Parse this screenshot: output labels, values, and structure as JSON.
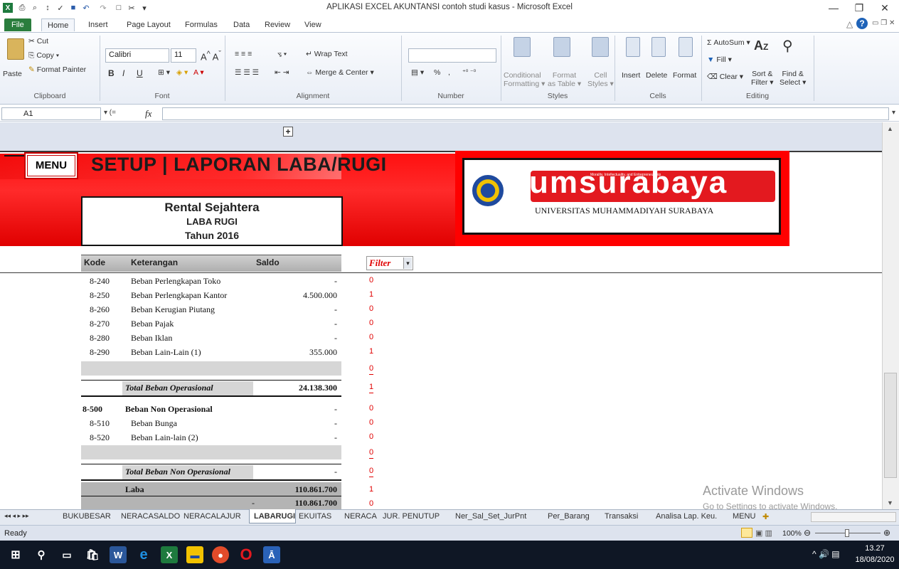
{
  "window": {
    "title": "APLIKASI EXCEL AKUNTANSI contoh studi kasus  -  Microsoft Excel",
    "min": "—",
    "restore": "❐",
    "close": "✕"
  },
  "ribbon_tabs": [
    "File",
    "Home",
    "Insert",
    "Page Layout",
    "Formulas",
    "Data",
    "Review",
    "View"
  ],
  "clipboard": {
    "paste": "Paste",
    "cut": "Cut",
    "copy": "Copy ▾",
    "format_painter": "Format Painter",
    "label": "Clipboard"
  },
  "font": {
    "name": "Calibri",
    "size": "11",
    "bold": "B",
    "italic": "I",
    "underline": "U",
    "label": "Font"
  },
  "alignment": {
    "wrap": "Wrap Text",
    "merge": "Merge & Center",
    "label": "Alignment"
  },
  "number": {
    "percent": "%",
    "comma": ",",
    "label": "Number"
  },
  "styles": {
    "conditional_1": "Conditional",
    "conditional_2": "Formatting ▾",
    "format_1": "Format",
    "format_2": "as Table ▾",
    "cell_1": "Cell",
    "cell_2": "Styles ▾",
    "label": "Styles"
  },
  "cells": {
    "insert": "Insert",
    "delete": "Delete",
    "format": "Format",
    "label": "Cells"
  },
  "editing": {
    "autosum": "Σ AutoSum ▾",
    "fill": "Fill ▾",
    "clear": "Clear ▾",
    "sort_1": "Sort &",
    "sort_2": "Filter ▾",
    "find_1": "Find &",
    "find_2": "Select ▾",
    "label": "Editing"
  },
  "formula_bar": {
    "cell_ref": "A1",
    "fx": "fx",
    "value": ""
  },
  "sheet": {
    "menu_button": "MENU",
    "heading": "SETUP | LAPORAN LABA/RUGI",
    "company": "Rental Sejahtera",
    "report": "LABA RUGI",
    "year": "Tahun 2016",
    "logo_main": "umsurabaya",
    "logo_tagline": "Morality, Intellectuality, and Entrepreneurship",
    "logo_sub": "UNIVERSITAS MUHAMMADIYAH SURABAYA",
    "col_kode": "Kode",
    "col_keterangan": "Keterangan",
    "col_saldo": "Saldo",
    "filter_label": "Filter",
    "rows": [
      {
        "kode": "8-240",
        "ket": "Beban Perlengkapan Toko",
        "saldo": "-",
        "filter": "0"
      },
      {
        "kode": "8-250",
        "ket": "Beban Perlengkapan Kantor",
        "saldo": "4.500.000",
        "filter": "1"
      },
      {
        "kode": "8-260",
        "ket": "Beban Kerugian Piutang",
        "saldo": "-",
        "filter": "0"
      },
      {
        "kode": "8-270",
        "ket": "Beban Pajak",
        "saldo": "-",
        "filter": "0"
      },
      {
        "kode": "8-280",
        "ket": "Beban Iklan",
        "saldo": "-",
        "filter": "0"
      },
      {
        "kode": "8-290",
        "ket": "Beban Lain-Lain (1)",
        "saldo": "355.000",
        "filter": "1"
      },
      {
        "kode": "",
        "ket": "",
        "saldo": "",
        "filter": "0"
      },
      {
        "kode": "",
        "ket": "Total Beban Operasional",
        "saldo": "24.138.300",
        "filter": "1"
      },
      {
        "kode": "8-500",
        "ket": "Beban Non Operasional",
        "saldo": "-",
        "filter": "0"
      },
      {
        "kode": "8-510",
        "ket": "Beban Bunga",
        "saldo": "-",
        "filter": "0"
      },
      {
        "kode": "8-520",
        "ket": "Beban Lain-lain (2)",
        "saldo": "-",
        "filter": "0"
      },
      {
        "kode": "",
        "ket": "",
        "saldo": "",
        "filter": "0"
      },
      {
        "kode": "",
        "ket": "Total Beban Non Operasional",
        "saldo": "-",
        "filter": "0"
      },
      {
        "kode": "",
        "ket": "Laba",
        "saldo": "110.861.700",
        "filter": "1"
      },
      {
        "kode": "",
        "ket": "-",
        "saldo": "110.861.700",
        "filter": "0"
      }
    ],
    "watermark_1": "Activate Windows",
    "watermark_2": "Go to Settings to activate Windows."
  },
  "sheet_tabs": [
    "BUKUBESAR",
    "NERACASALDO",
    "NERACALAJUR",
    "LABARUGI",
    "EKUITAS",
    "NERACA",
    "JUR. PENUTUP",
    "Ner_Sal_Set_JurPnt",
    "Per_Barang",
    "Transaksi",
    "Analisa Lap. Keu.",
    "MENU"
  ],
  "status": {
    "ready": "Ready",
    "zoom": "100%"
  },
  "taskbar": {
    "time": "13.27",
    "date": "18/08/2020"
  },
  "colors": {
    "accent_red": "#e60000",
    "excel_green": "#2a7d3d",
    "header_gray": "#b4b4b4"
  }
}
